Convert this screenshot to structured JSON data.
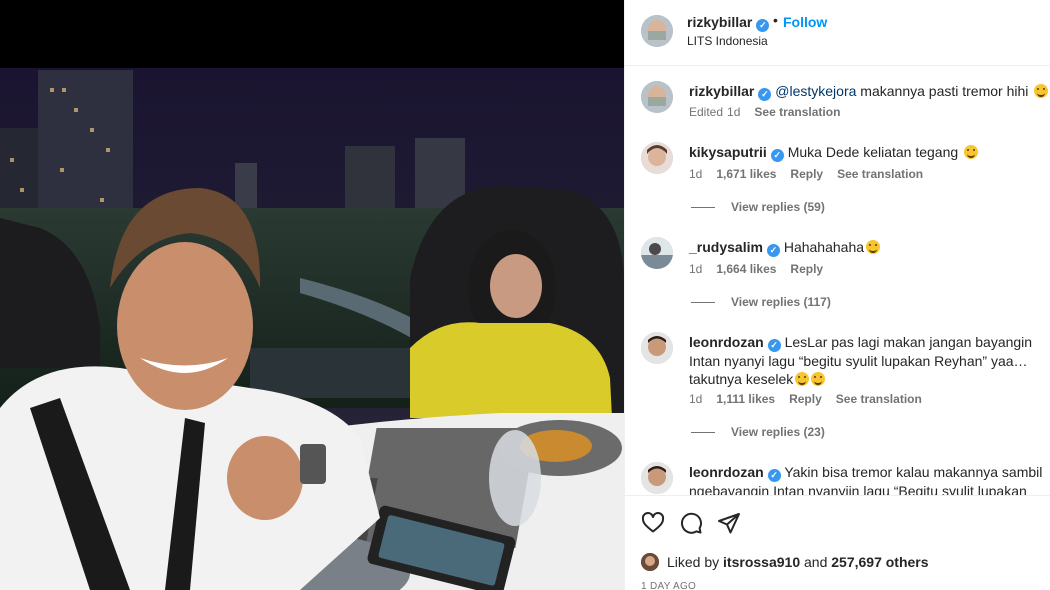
{
  "post": {
    "username": "rizkybillar",
    "follow_label": "Follow",
    "dot": "•",
    "location": "LITS Indonesia"
  },
  "comments": [
    {
      "username": "rizkybillar",
      "mention": "@lestykejora",
      "text": " makannya pasti tremor hihi",
      "edited": "Edited",
      "age": "1d",
      "see_translation": "See translation"
    },
    {
      "username": "kikysaputrii",
      "text": "Muka Dede keliatan tegang",
      "age": "1d",
      "likes": "1,671 likes",
      "reply": "Reply",
      "see_translation": "See translation",
      "view_replies": "View replies (59)"
    },
    {
      "username": "_rudysalim",
      "text": "Hahahahaha",
      "age": "1d",
      "likes": "1,664 likes",
      "reply": "Reply",
      "view_replies": "View replies (117)"
    },
    {
      "username": "leonrdozan",
      "text": "LesLar pas lagi makan jangan bayangin Intan nyanyi lagu “begitu syulit lupakan Reyhan” yaa… takutnya keselek",
      "age": "1d",
      "likes": "1,111 likes",
      "reply": "Reply",
      "see_translation": "See translation",
      "view_replies": "View replies (23)"
    },
    {
      "username": "leonrdozan",
      "text": "Yakin bisa tremor kalau makannya sambil ngebayangin Intan nyanyiin lagu “Begitu syulit lupakan"
    }
  ],
  "likes": {
    "prefix": "Liked by ",
    "user": "itsrossa910",
    "middle": " and ",
    "others": "257,697 others"
  },
  "date": "1 DAY AGO",
  "icons": {
    "like": "heart-icon",
    "comment": "comment-bubble-icon",
    "share": "paper-plane-icon",
    "verified": "verified-badge-icon"
  },
  "colors": {
    "link_blue": "#0095f6",
    "verified_blue": "#3897f0",
    "muted": "#737373",
    "text": "#262626"
  }
}
